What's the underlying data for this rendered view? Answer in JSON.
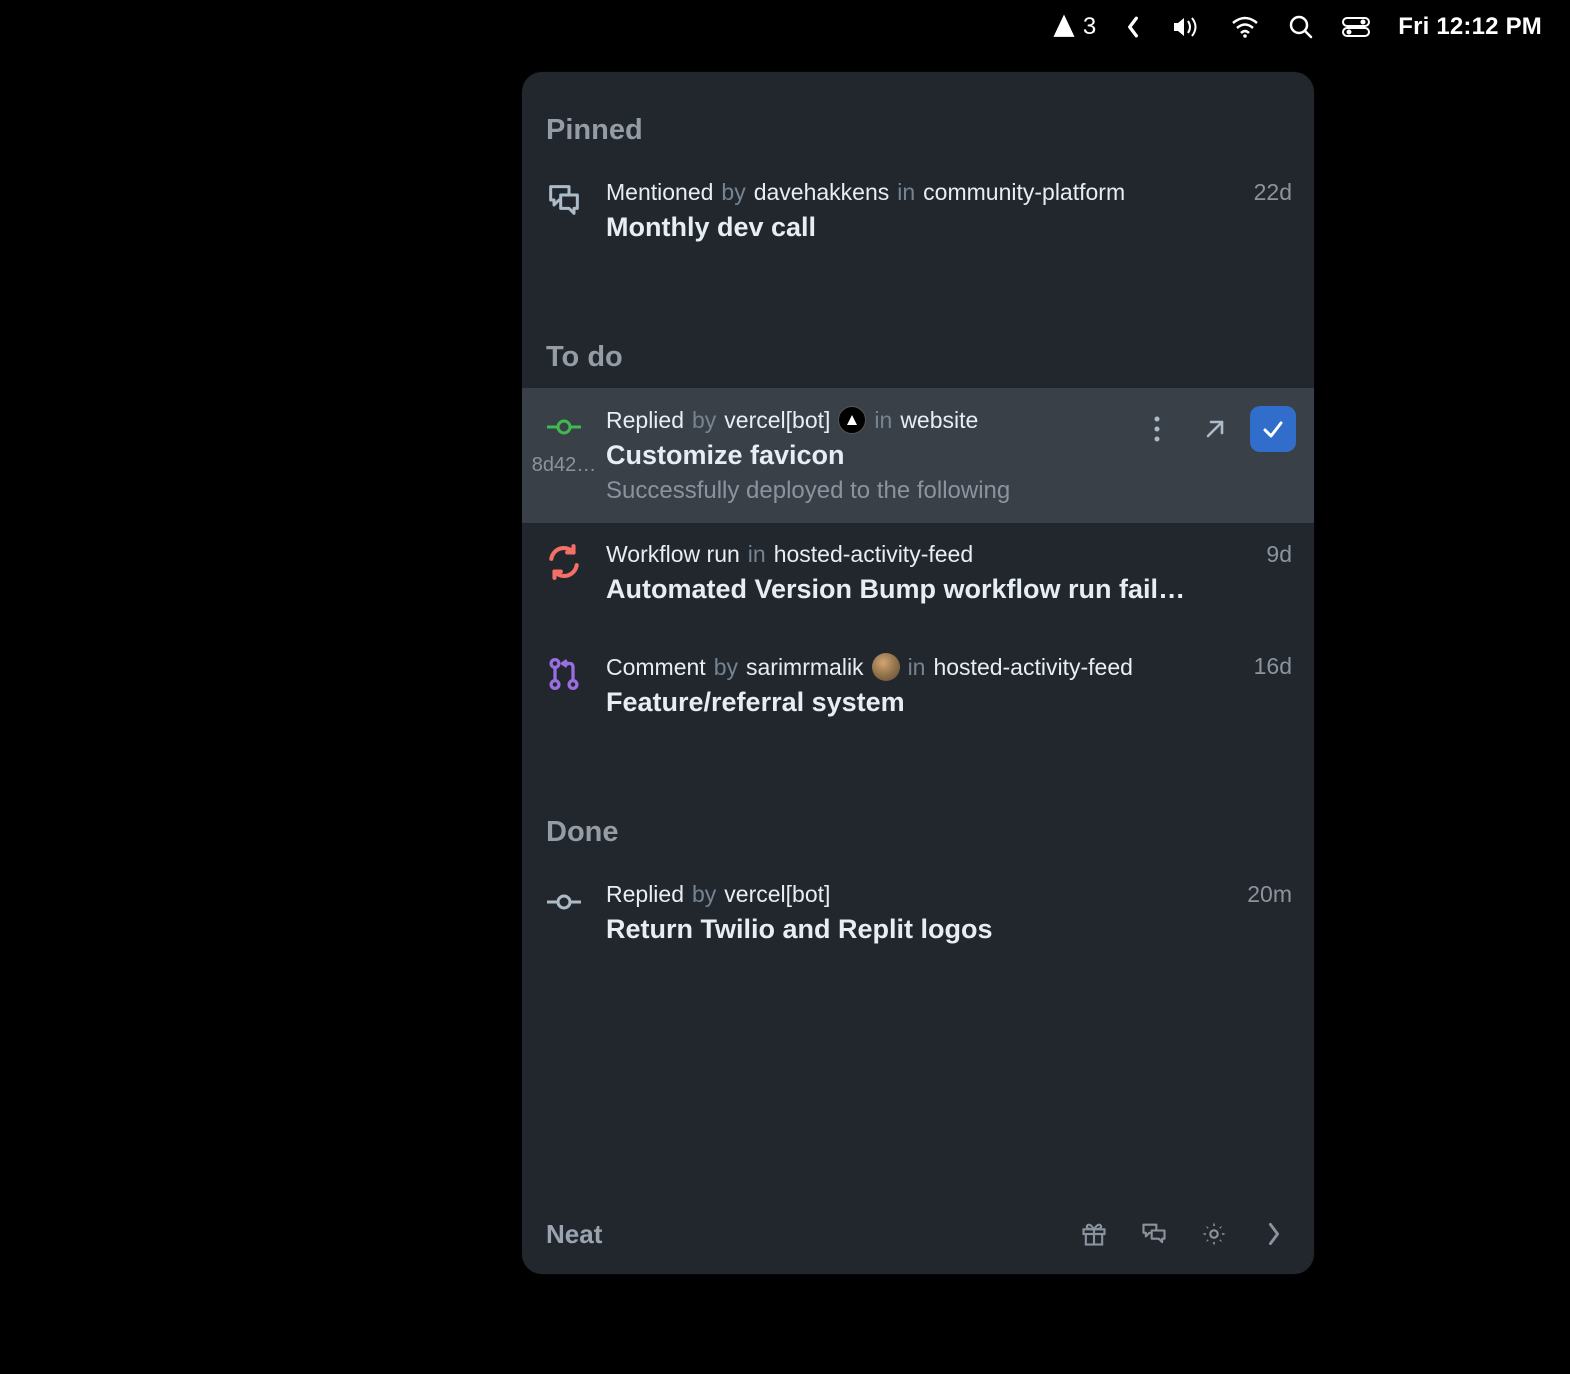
{
  "menubar": {
    "notifications_count": "3",
    "clock": "Fri 12:12 PM"
  },
  "sections": {
    "pinned": {
      "label": "Pinned",
      "items": [
        {
          "action": "Mentioned",
          "by": "by",
          "actor": "davehakkens",
          "in": "in",
          "repo": "community-platform",
          "title": "Monthly dev call",
          "time": "22d"
        }
      ]
    },
    "todo": {
      "label": "To do",
      "items": [
        {
          "action": "Replied",
          "by": "by",
          "actor": "vercel[bot]",
          "in": "in",
          "repo": "website",
          "title": "Customize favicon",
          "subtitle": "Successfully deployed to the following",
          "time": "",
          "hash": "8d42…"
        },
        {
          "action": "Workflow run",
          "in": "in",
          "repo": "hosted-activity-feed",
          "title": "Automated Version Bump workflow run failed…",
          "time": "9d"
        },
        {
          "action": "Comment",
          "by": "by",
          "actor": "sarimrmalik",
          "in": "in",
          "repo": "hosted-activity-feed",
          "title": "Feature/referral system",
          "time": "16d"
        }
      ]
    },
    "done": {
      "label": "Done",
      "items": [
        {
          "action": "Replied",
          "by": "by",
          "actor": "vercel[bot]",
          "title": "Return Twilio and Replit logos",
          "time": "20m"
        }
      ]
    }
  },
  "footer": {
    "app_name": "Neat"
  }
}
